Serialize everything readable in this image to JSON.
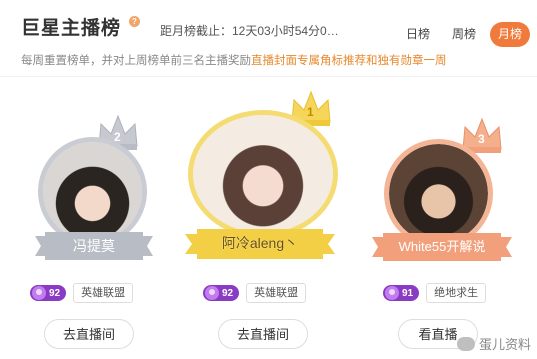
{
  "header": {
    "title": "巨星主播榜",
    "help_mark": "?",
    "countdown": "距月榜截止：12天03小时54分0…",
    "subtitle_plain": "每周重置榜单，并对上周榜单前三名主播奖励",
    "subtitle_highlight": "直播封面专属角标推荐和独有勋章一周"
  },
  "tabs": [
    {
      "label": "日榜",
      "active": false
    },
    {
      "label": "周榜",
      "active": false
    },
    {
      "label": "月榜",
      "active": true
    }
  ],
  "streamers": [
    {
      "rank": "2",
      "name": "冯提莫",
      "fan_level": "92",
      "game": "英雄联盟",
      "button": "去直播间"
    },
    {
      "rank": "1",
      "name": "阿冷aleng丶",
      "fan_level": "92",
      "game": "英雄联盟",
      "button": "去直播间"
    },
    {
      "rank": "3",
      "name": "White55开解说",
      "fan_level": "91",
      "game": "绝地求生",
      "button": "看直播"
    }
  ],
  "watermark": "蛋儿资料",
  "colors": {
    "accent": "#f07a3c",
    "silver": "#b8bcc4",
    "gold": "#f3cf45",
    "bronze": "#f2a07b",
    "fan_badge": "#8a3bc4"
  },
  "icons": [
    "help-icon",
    "crown-silver-icon",
    "crown-gold-icon",
    "crown-bronze-icon",
    "fan-gem-icon",
    "wechat-icon"
  ]
}
